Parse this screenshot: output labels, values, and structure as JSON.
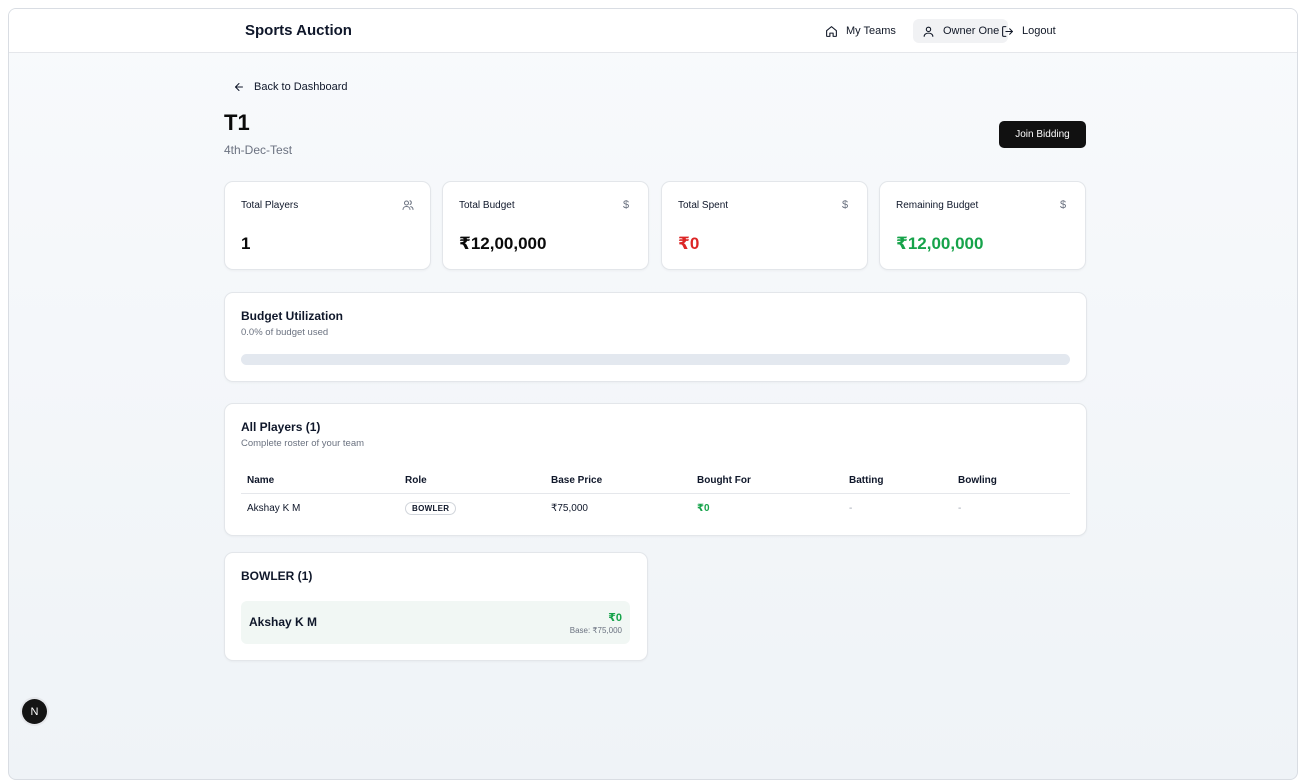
{
  "brand": "Sports Auction",
  "nav": {
    "my_teams": "My Teams",
    "owner": "Owner One",
    "logout": "Logout"
  },
  "back_link": "Back to Dashboard",
  "team": {
    "name": "T1",
    "auction": "4th-Dec-Test",
    "join_button": "Join Bidding"
  },
  "stats": [
    {
      "label": "Total Players",
      "value": "1",
      "icon": "users-icon"
    },
    {
      "label": "Total Budget",
      "value": "₹12,00,000",
      "icon": "dollar-icon"
    },
    {
      "label": "Total Spent",
      "value": "₹0",
      "icon": "dollar-icon",
      "color": "#dc2626"
    },
    {
      "label": "Remaining Budget",
      "value": "₹12,00,000",
      "icon": "dollar-icon",
      "color": "#16a34a"
    }
  ],
  "budget_utilization": {
    "title": "Budget Utilization",
    "subtitle": "0.0% of budget used",
    "percent": 0
  },
  "players_table": {
    "title": "All Players (1)",
    "subtitle": "Complete roster of your team",
    "columns": [
      "Name",
      "Role",
      "Base Price",
      "Bought For",
      "Batting",
      "Bowling"
    ],
    "rows": [
      {
        "name": "Akshay K M",
        "role": "BOWLER",
        "base_price": "₹75,000",
        "bought_for": "₹0",
        "batting": "-",
        "bowling": "-"
      }
    ]
  },
  "role_group": {
    "title": "BOWLER (1)",
    "players": [
      {
        "name": "Akshay K M",
        "price": "₹0",
        "base": "Base: ₹75,000"
      }
    ]
  },
  "colors": {
    "spent": "#dc2626",
    "remaining": "#16a34a",
    "primary_button": "#111111"
  },
  "floating_badge": "N"
}
